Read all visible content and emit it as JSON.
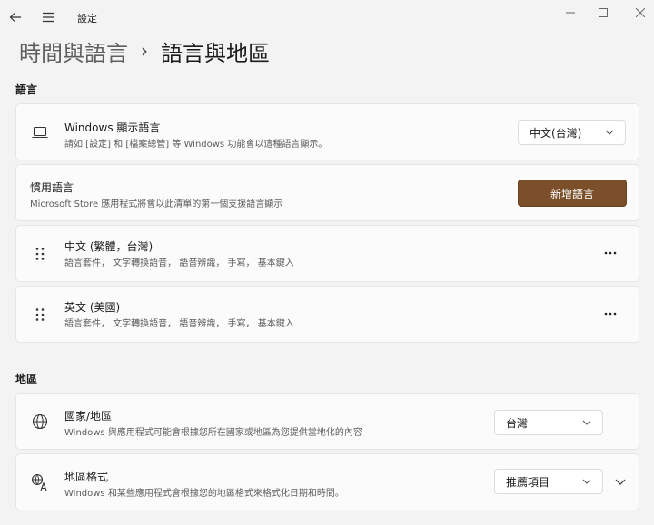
{
  "app": {
    "title": "設定"
  },
  "breadcrumb": {
    "parent": "時間與語言",
    "separator": "›",
    "current": "語言與地區"
  },
  "sections": {
    "language": "語言",
    "region": "地區"
  },
  "display_language": {
    "title": "Windows 顯示語言",
    "desc": "請如 [設定] 和 [檔案總管] 等 Windows 功能會以這種語言顯示。",
    "value": "中文(台灣)"
  },
  "preferred_languages": {
    "title": "慣用語言",
    "desc": "Microsoft Store 應用程式將會以此清單的第一個支援語言顯示",
    "add_button": "新增語言"
  },
  "languages": [
    {
      "name": "中文 (繁體，台灣)",
      "features": "語言套件， 文字轉換語音， 語音辨識， 手寫， 基本鍵入"
    },
    {
      "name": "英文 (美國)",
      "features": "語言套件， 文字轉換語音， 語音辨識， 手寫， 基本鍵入"
    }
  ],
  "country": {
    "title": "國家/地區",
    "desc": "Windows 與應用程式可能會根據您所在國家或地區為您提供當地化的內容",
    "value": "台灣"
  },
  "regional_format": {
    "title": "地區格式",
    "desc": "Windows 和某些應用程式會根據您的地區格式來格式化日期和時間。",
    "value": "推薦項目"
  },
  "more_glyph": "···"
}
